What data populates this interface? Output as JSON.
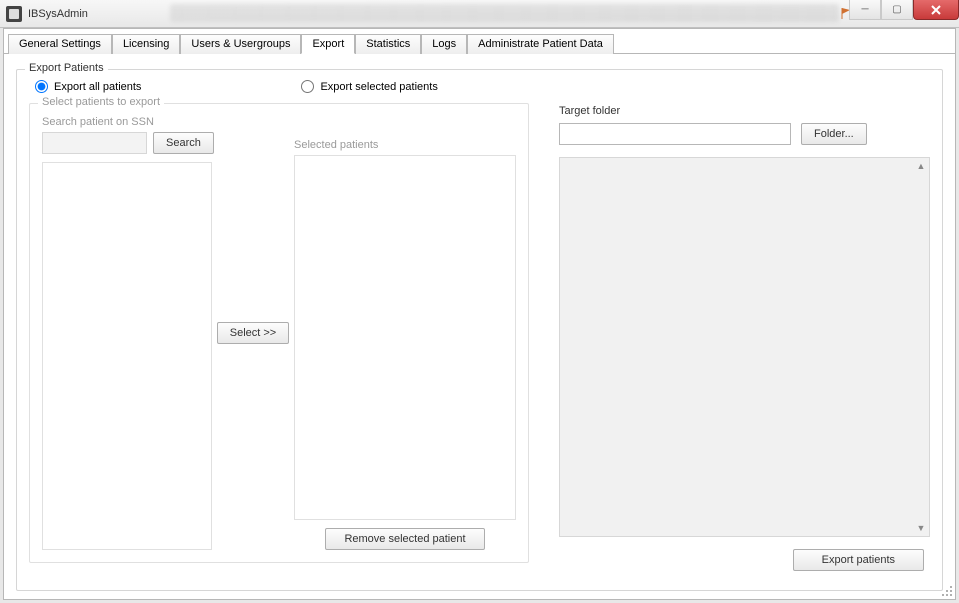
{
  "window": {
    "title": "IBSysAdmin"
  },
  "tabs": [
    {
      "label": "General Settings"
    },
    {
      "label": "Licensing"
    },
    {
      "label": "Users & Usergroups"
    },
    {
      "label": "Export",
      "active": true
    },
    {
      "label": "Statistics"
    },
    {
      "label": "Logs"
    },
    {
      "label": "Administrate Patient Data"
    }
  ],
  "export": {
    "group_title": "Export Patients",
    "radio_all": "Export all patients",
    "radio_selected": "Export selected patients",
    "radio_value": "all",
    "select_group_title": "Select patients to export",
    "search_label": "Search patient on SSN",
    "search_button": "Search",
    "search_value": "",
    "select_button": "Select >>",
    "selected_label": "Selected patients",
    "remove_button": "Remove selected patient",
    "target_label": "Target folder",
    "target_value": "",
    "folder_button": "Folder...",
    "log_value": "",
    "export_button": "Export patients"
  }
}
